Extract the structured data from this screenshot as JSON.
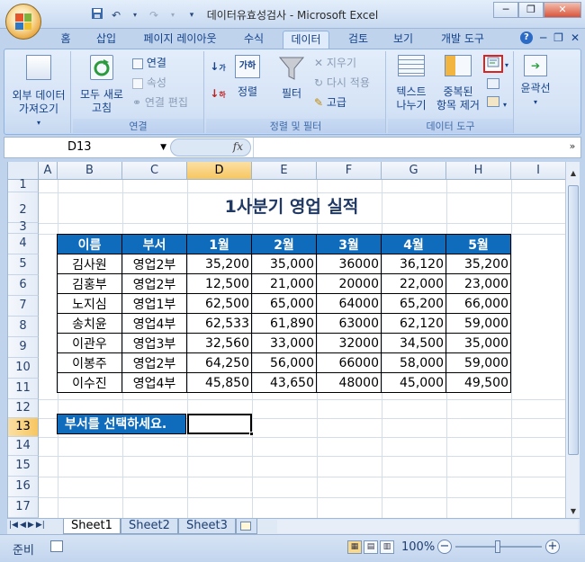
{
  "window": {
    "title": "데이터유효성검사 - Microsoft Excel"
  },
  "ribbon_tabs": [
    "홈",
    "삽입",
    "페이지 레이아웃",
    "수식",
    "데이터",
    "검토",
    "보기",
    "개발 도구"
  ],
  "active_tab": "데이터",
  "ribbon": {
    "external_data": "외부 데이터\n가져오기",
    "refresh_all": "모두 새로\n고침",
    "connections": "연결",
    "properties": "속성",
    "edit_links": "연결 편집",
    "group_connections": "연결",
    "sort": "정렬",
    "filter": "필터",
    "clear": "지우기",
    "reapply": "다시 적용",
    "advanced": "고급",
    "group_sort_filter": "정렬 및 필터",
    "text_to_columns": "텍스트\n나누기",
    "remove_duplicates": "중복된\n항목 제거",
    "group_data_tools": "데이터 도구",
    "outline": "윤곽선"
  },
  "formula_bar": {
    "name_box": "D13",
    "fx": "fx",
    "formula": ""
  },
  "columns": [
    "A",
    "B",
    "C",
    "D",
    "E",
    "F",
    "G",
    "H",
    "I"
  ],
  "rows": [
    "1",
    "2",
    "3",
    "4",
    "5",
    "6",
    "7",
    "8",
    "9",
    "10",
    "11",
    "12",
    "13",
    "14",
    "15",
    "16",
    "17"
  ],
  "selected_column": "D",
  "selected_row": "13",
  "sheet": {
    "title": "1사분기 영업 실적",
    "headers": [
      "이름",
      "부서",
      "1월",
      "2월",
      "3월",
      "4월",
      "5월"
    ],
    "rows": [
      [
        "김사원",
        "영업2부",
        "35,200",
        "35,000",
        "36000",
        "36,120",
        "35,200"
      ],
      [
        "김홍부",
        "영업2부",
        "12,500",
        "21,000",
        "20000",
        "22,000",
        "23,000"
      ],
      [
        "노지심",
        "영업1부",
        "62,500",
        "65,000",
        "64000",
        "65,200",
        "66,000"
      ],
      [
        "송치윤",
        "영업4부",
        "62,533",
        "61,890",
        "63000",
        "62,120",
        "59,000"
      ],
      [
        "이관우",
        "영업3부",
        "32,560",
        "33,000",
        "32000",
        "34,500",
        "35,000"
      ],
      [
        "이봉주",
        "영업2부",
        "64,250",
        "56,000",
        "66000",
        "58,000",
        "59,000"
      ],
      [
        "이수진",
        "영업4부",
        "45,850",
        "43,650",
        "48000",
        "45,000",
        "49,500"
      ]
    ],
    "prompt": "부서를 선택하세요."
  },
  "sheet_tabs": [
    "Sheet1",
    "Sheet2",
    "Sheet3"
  ],
  "active_sheet": "Sheet1",
  "status": {
    "mode": "준비",
    "zoom": "100%"
  },
  "colors": {
    "header_blue": "#0f6cbd",
    "title_navy": "#1f3864"
  }
}
